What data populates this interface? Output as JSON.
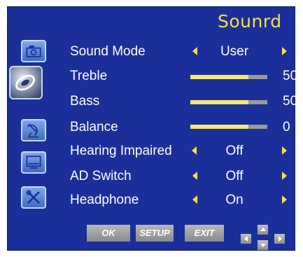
{
  "title": "Sounrd",
  "menu": {
    "rows": [
      {
        "label": "Sound Mode",
        "value": "User"
      },
      {
        "label": "Treble",
        "value": "50",
        "level": 0.75
      },
      {
        "label": "Bass",
        "value": "50",
        "level": 0.75
      },
      {
        "label": "Balance",
        "value": "0",
        "level": 0.75
      },
      {
        "label": "Hearing Impaired",
        "value": "Off"
      },
      {
        "label": "AD Switch",
        "value": "Off"
      },
      {
        "label": "Headphone",
        "value": "On"
      }
    ]
  },
  "sidebar": {
    "icons": [
      "picture-icon",
      "sound-icon",
      "channel-icon",
      "screen-icon",
      "setup-icon"
    ]
  },
  "footer": {
    "ok_label": "OK",
    "setup_label": "SETUP",
    "exit_label": "EXIT"
  },
  "colors": {
    "panel_bg": "#1a2f9a",
    "accent": "#f4e04a",
    "slider_fill": "#f4e877",
    "slider_track": "#9a9a9a"
  }
}
